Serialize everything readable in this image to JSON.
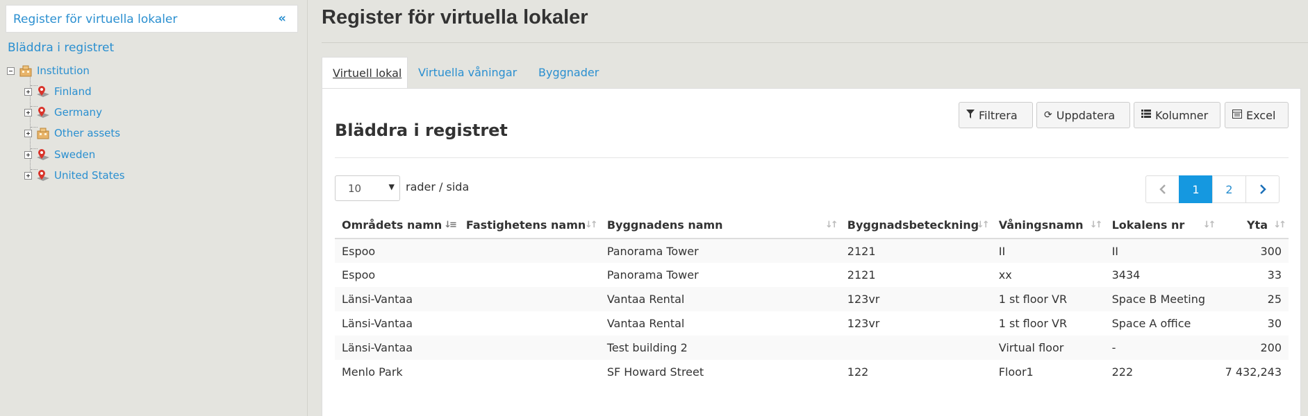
{
  "sidebar": {
    "header_title": "Register för virtuella lokaler",
    "collapse_glyph": "«",
    "browse_link": "Bläddra i registret",
    "tree": {
      "root": {
        "label": "Institution",
        "icon": "building-icon"
      },
      "children": [
        {
          "label": "Finland",
          "icon": "map-pin-icon"
        },
        {
          "label": "Germany",
          "icon": "map-pin-icon"
        },
        {
          "label": "Other assets",
          "icon": "building-icon"
        },
        {
          "label": "Sweden",
          "icon": "map-pin-icon"
        },
        {
          "label": "United States",
          "icon": "map-pin-icon"
        }
      ]
    }
  },
  "main": {
    "page_title": "Register för virtuella lokaler",
    "tabs": [
      {
        "label": "Virtuell lokal",
        "active": true
      },
      {
        "label": "Virtuella våningar",
        "active": false
      },
      {
        "label": "Byggnader",
        "active": false
      }
    ],
    "panel_title": "Bläddra i registret",
    "toolbar": {
      "filter_label": "Filtrera",
      "refresh_label": "Uppdatera",
      "columns_label": "Kolumner",
      "excel_label": "Excel"
    },
    "rows_per_page": {
      "value": "10",
      "label": "rader / sida"
    },
    "pager": {
      "prev": "‹",
      "pages": [
        "1",
        "2"
      ],
      "current": "1",
      "next": "›"
    },
    "table": {
      "columns": [
        "Områdets namn",
        "Fastighetens namn",
        "Byggnadens namn",
        "Byggnadsbeteckning",
        "Våningsnamn",
        "Lokalens nr",
        "Yta"
      ],
      "rows": [
        [
          "Espoo",
          "",
          "Panorama Tower",
          "2121",
          "II",
          "II",
          "300"
        ],
        [
          "Espoo",
          "",
          "Panorama Tower",
          "2121",
          "xx",
          "3434",
          "33"
        ],
        [
          "Länsi-Vantaa",
          "",
          "Vantaa Rental",
          "123vr",
          "1 st floor VR",
          "Space B Meeting",
          "25"
        ],
        [
          "Länsi-Vantaa",
          "",
          "Vantaa Rental",
          "123vr",
          "1 st floor VR",
          "Space A office",
          "30"
        ],
        [
          "Länsi-Vantaa",
          "",
          "Test building 2",
          "",
          "Virtual floor",
          "-",
          "200"
        ],
        [
          "Menlo Park",
          "",
          "SF Howard Street",
          "122",
          "Floor1",
          "222",
          "7 432,243"
        ]
      ]
    }
  },
  "colors": {
    "link": "#2a8fd0",
    "pager_active": "#1598e0",
    "background": "#e4e4df"
  }
}
